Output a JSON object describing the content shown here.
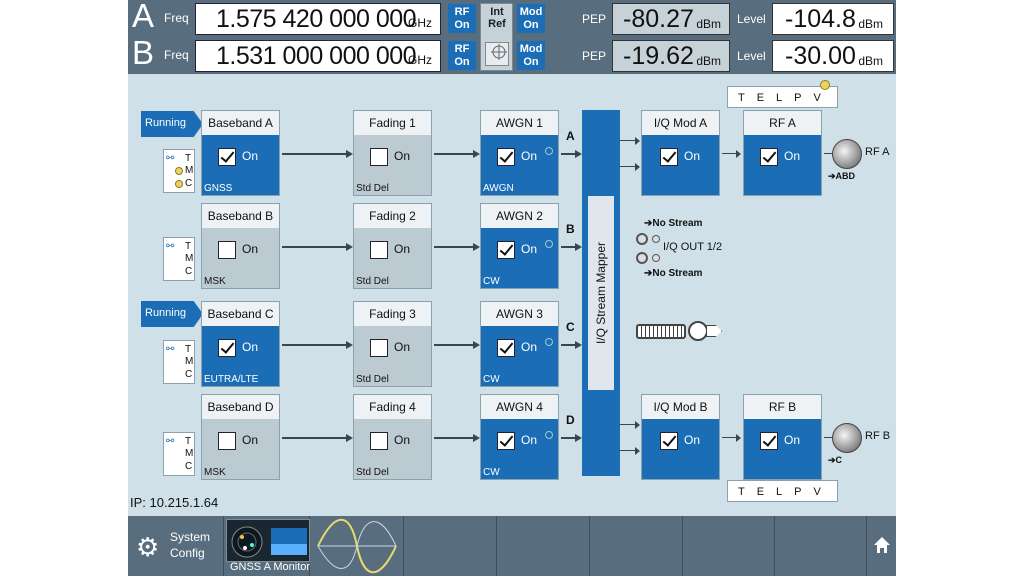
{
  "header": {
    "rows": [
      {
        "letter": "A",
        "freq_label": "Freq",
        "freq_value": "1.575 420 000 000",
        "freq_unit": "GHz",
        "rf": "RF\nOn",
        "mod": "Mod\nOn",
        "pep_label": "PEP",
        "pep_value": "-80.27",
        "pep_unit": "dBm",
        "level_label": "Level",
        "level_value": "-104.8",
        "level_unit": "dBm"
      },
      {
        "letter": "B",
        "freq_label": "Freq",
        "freq_value": "1.531 000 000 000",
        "freq_unit": "GHz",
        "rf": "RF\nOn",
        "mod": "Mod\nOn",
        "pep_label": "PEP",
        "pep_value": "-19.62",
        "pep_unit": "dBm",
        "level_label": "Level",
        "level_value": "-30.00",
        "level_unit": "dBm"
      }
    ],
    "int_ref": "Int\nRef"
  },
  "running_label": "Running",
  "tmc": {
    "t": "T",
    "m": "M",
    "c": "C"
  },
  "basebands": [
    {
      "title": "Baseband A",
      "on_label": "On",
      "checked": true,
      "sub": "GNSS"
    },
    {
      "title": "Baseband B",
      "on_label": "On",
      "checked": false,
      "sub": "MSK"
    },
    {
      "title": "Baseband C",
      "on_label": "On",
      "checked": true,
      "sub": "EUTRA/LTE"
    },
    {
      "title": "Baseband D",
      "on_label": "On",
      "checked": false,
      "sub": "MSK"
    }
  ],
  "fadings": [
    {
      "title": "Fading 1",
      "on_label": "On",
      "checked": false,
      "sub": "Std Del"
    },
    {
      "title": "Fading 2",
      "on_label": "On",
      "checked": false,
      "sub": "Std Del"
    },
    {
      "title": "Fading 3",
      "on_label": "On",
      "checked": false,
      "sub": "Std Del"
    },
    {
      "title": "Fading 4",
      "on_label": "On",
      "checked": false,
      "sub": "Std Del"
    }
  ],
  "awgns": [
    {
      "title": "AWGN 1",
      "on_label": "On",
      "checked": true,
      "sub": "AWGN"
    },
    {
      "title": "AWGN 2",
      "on_label": "On",
      "checked": true,
      "sub": "CW"
    },
    {
      "title": "AWGN 3",
      "on_label": "On",
      "checked": true,
      "sub": "CW"
    },
    {
      "title": "AWGN 4",
      "on_label": "On",
      "checked": true,
      "sub": "CW"
    }
  ],
  "channels": [
    "A",
    "B",
    "C",
    "D"
  ],
  "stream_mapper": "I/Q Stream Mapper",
  "iqmods": [
    {
      "title": "I/Q Mod A",
      "on_label": "On",
      "checked": true
    },
    {
      "title": "I/Q Mod B",
      "on_label": "On",
      "checked": true
    }
  ],
  "rfs": [
    {
      "title": "RF A",
      "on_label": "On",
      "checked": true,
      "conn_label": "RF A",
      "sub": "➔ABD"
    },
    {
      "title": "RF B",
      "on_label": "On",
      "checked": true,
      "conn_label": "RF B",
      "sub": "➔C"
    }
  ],
  "telpv": "TELPV",
  "no_stream": "➔No Stream",
  "iq_out": "I/Q OUT 1/2",
  "ip": "IP: 10.215.1.64",
  "taskbar": {
    "system_config": "System\nConfig",
    "monitor_label": "GNSS A Monitor"
  }
}
